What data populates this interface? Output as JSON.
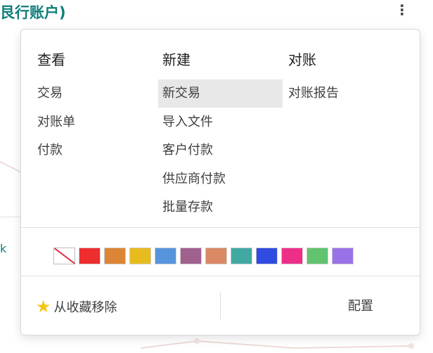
{
  "background": {
    "title_fragment": "艮行账户)",
    "kebab_icon": "vertical-ellipsis-icon",
    "side_text": "k"
  },
  "dropdown": {
    "columns": {
      "view": {
        "header": "查看",
        "items": [
          "交易",
          "对账单",
          "付款"
        ]
      },
      "new": {
        "header": "新建",
        "items": [
          "新交易",
          "导入文件",
          "客户付款",
          "供应商付款",
          "批量存款"
        ],
        "active_item": "新交易"
      },
      "reconcile": {
        "header": "对账",
        "items": [
          "对账报告"
        ]
      }
    },
    "colors": [
      "none",
      "#ee2d2d",
      "#dc8534",
      "#e8bb1d",
      "#5794dd",
      "#9f628f",
      "#db8865",
      "#41a9a2",
      "#304be0",
      "#ee2f8a",
      "#61c36e",
      "#9872e6"
    ],
    "favorite": {
      "icon": "star-icon",
      "label": "从收藏移除"
    },
    "configure_label": "配置"
  }
}
